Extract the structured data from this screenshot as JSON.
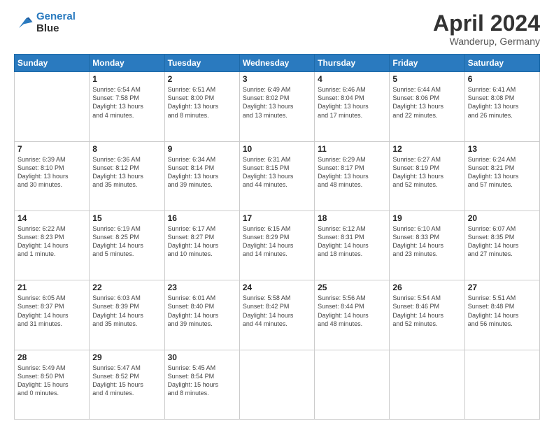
{
  "logo": {
    "line1": "General",
    "line2": "Blue"
  },
  "title": "April 2024",
  "location": "Wanderup, Germany",
  "days_of_week": [
    "Sunday",
    "Monday",
    "Tuesday",
    "Wednesday",
    "Thursday",
    "Friday",
    "Saturday"
  ],
  "weeks": [
    [
      {
        "day": "",
        "info": ""
      },
      {
        "day": "1",
        "info": "Sunrise: 6:54 AM\nSunset: 7:58 PM\nDaylight: 13 hours\nand 4 minutes."
      },
      {
        "day": "2",
        "info": "Sunrise: 6:51 AM\nSunset: 8:00 PM\nDaylight: 13 hours\nand 8 minutes."
      },
      {
        "day": "3",
        "info": "Sunrise: 6:49 AM\nSunset: 8:02 PM\nDaylight: 13 hours\nand 13 minutes."
      },
      {
        "day": "4",
        "info": "Sunrise: 6:46 AM\nSunset: 8:04 PM\nDaylight: 13 hours\nand 17 minutes."
      },
      {
        "day": "5",
        "info": "Sunrise: 6:44 AM\nSunset: 8:06 PM\nDaylight: 13 hours\nand 22 minutes."
      },
      {
        "day": "6",
        "info": "Sunrise: 6:41 AM\nSunset: 8:08 PM\nDaylight: 13 hours\nand 26 minutes."
      }
    ],
    [
      {
        "day": "7",
        "info": "Sunrise: 6:39 AM\nSunset: 8:10 PM\nDaylight: 13 hours\nand 30 minutes."
      },
      {
        "day": "8",
        "info": "Sunrise: 6:36 AM\nSunset: 8:12 PM\nDaylight: 13 hours\nand 35 minutes."
      },
      {
        "day": "9",
        "info": "Sunrise: 6:34 AM\nSunset: 8:14 PM\nDaylight: 13 hours\nand 39 minutes."
      },
      {
        "day": "10",
        "info": "Sunrise: 6:31 AM\nSunset: 8:15 PM\nDaylight: 13 hours\nand 44 minutes."
      },
      {
        "day": "11",
        "info": "Sunrise: 6:29 AM\nSunset: 8:17 PM\nDaylight: 13 hours\nand 48 minutes."
      },
      {
        "day": "12",
        "info": "Sunrise: 6:27 AM\nSunset: 8:19 PM\nDaylight: 13 hours\nand 52 minutes."
      },
      {
        "day": "13",
        "info": "Sunrise: 6:24 AM\nSunset: 8:21 PM\nDaylight: 13 hours\nand 57 minutes."
      }
    ],
    [
      {
        "day": "14",
        "info": "Sunrise: 6:22 AM\nSunset: 8:23 PM\nDaylight: 14 hours\nand 1 minute."
      },
      {
        "day": "15",
        "info": "Sunrise: 6:19 AM\nSunset: 8:25 PM\nDaylight: 14 hours\nand 5 minutes."
      },
      {
        "day": "16",
        "info": "Sunrise: 6:17 AM\nSunset: 8:27 PM\nDaylight: 14 hours\nand 10 minutes."
      },
      {
        "day": "17",
        "info": "Sunrise: 6:15 AM\nSunset: 8:29 PM\nDaylight: 14 hours\nand 14 minutes."
      },
      {
        "day": "18",
        "info": "Sunrise: 6:12 AM\nSunset: 8:31 PM\nDaylight: 14 hours\nand 18 minutes."
      },
      {
        "day": "19",
        "info": "Sunrise: 6:10 AM\nSunset: 8:33 PM\nDaylight: 14 hours\nand 23 minutes."
      },
      {
        "day": "20",
        "info": "Sunrise: 6:07 AM\nSunset: 8:35 PM\nDaylight: 14 hours\nand 27 minutes."
      }
    ],
    [
      {
        "day": "21",
        "info": "Sunrise: 6:05 AM\nSunset: 8:37 PM\nDaylight: 14 hours\nand 31 minutes."
      },
      {
        "day": "22",
        "info": "Sunrise: 6:03 AM\nSunset: 8:39 PM\nDaylight: 14 hours\nand 35 minutes."
      },
      {
        "day": "23",
        "info": "Sunrise: 6:01 AM\nSunset: 8:40 PM\nDaylight: 14 hours\nand 39 minutes."
      },
      {
        "day": "24",
        "info": "Sunrise: 5:58 AM\nSunset: 8:42 PM\nDaylight: 14 hours\nand 44 minutes."
      },
      {
        "day": "25",
        "info": "Sunrise: 5:56 AM\nSunset: 8:44 PM\nDaylight: 14 hours\nand 48 minutes."
      },
      {
        "day": "26",
        "info": "Sunrise: 5:54 AM\nSunset: 8:46 PM\nDaylight: 14 hours\nand 52 minutes."
      },
      {
        "day": "27",
        "info": "Sunrise: 5:51 AM\nSunset: 8:48 PM\nDaylight: 14 hours\nand 56 minutes."
      }
    ],
    [
      {
        "day": "28",
        "info": "Sunrise: 5:49 AM\nSunset: 8:50 PM\nDaylight: 15 hours\nand 0 minutes."
      },
      {
        "day": "29",
        "info": "Sunrise: 5:47 AM\nSunset: 8:52 PM\nDaylight: 15 hours\nand 4 minutes."
      },
      {
        "day": "30",
        "info": "Sunrise: 5:45 AM\nSunset: 8:54 PM\nDaylight: 15 hours\nand 8 minutes."
      },
      {
        "day": "",
        "info": ""
      },
      {
        "day": "",
        "info": ""
      },
      {
        "day": "",
        "info": ""
      },
      {
        "day": "",
        "info": ""
      }
    ]
  ]
}
